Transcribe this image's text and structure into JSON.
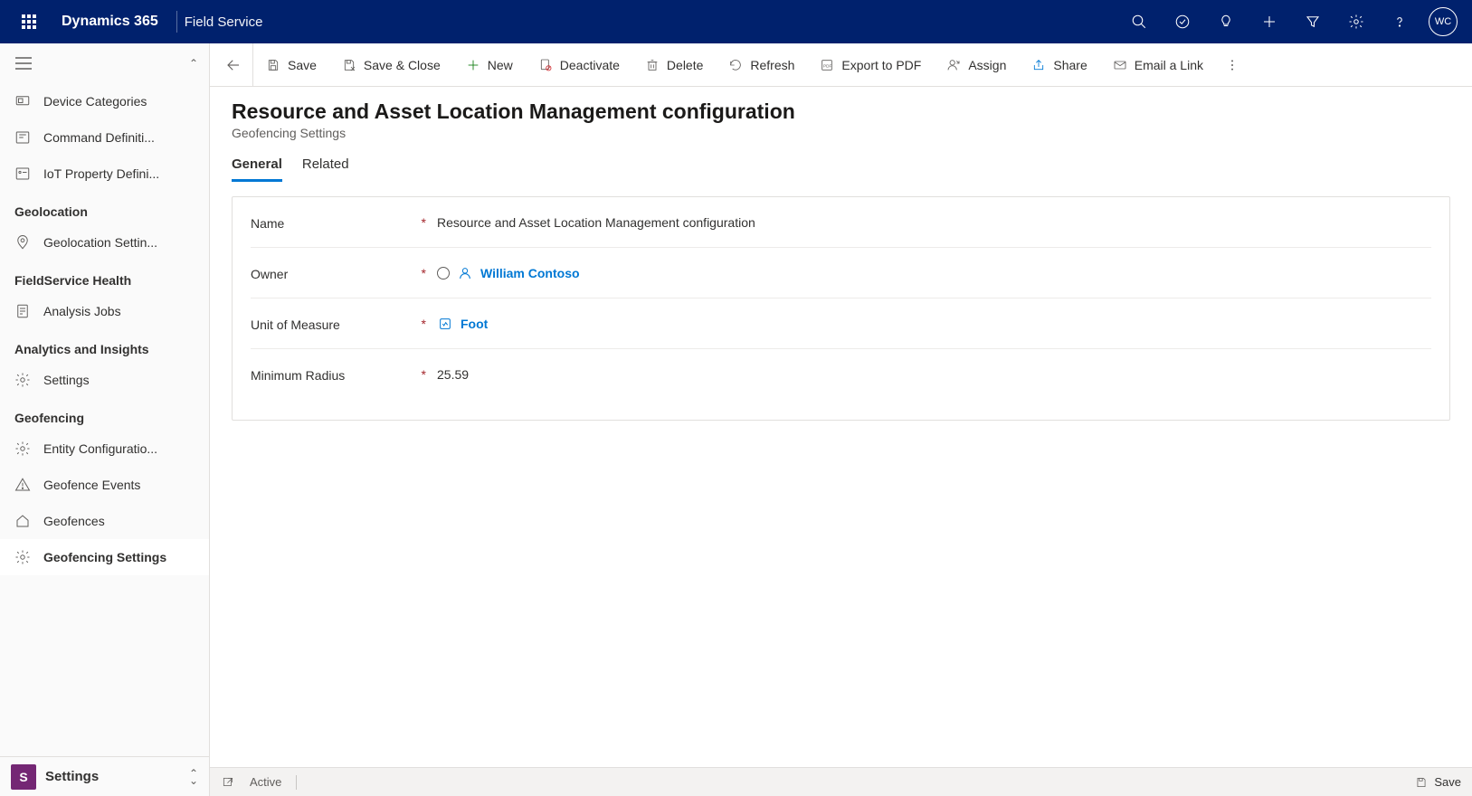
{
  "header": {
    "brand": "Dynamics 365",
    "app_name": "Field Service",
    "avatar_initials": "WC"
  },
  "sidebar": {
    "ungrouped_items": [
      {
        "label": "Device Categories",
        "icon": "devcat"
      },
      {
        "label": "Command Definiti...",
        "icon": "cmddef"
      },
      {
        "label": "IoT Property Defini...",
        "icon": "iotprop"
      }
    ],
    "groups": [
      {
        "title": "Geolocation",
        "items": [
          {
            "label": "Geolocation Settin...",
            "icon": "geo"
          }
        ]
      },
      {
        "title": "FieldService Health",
        "items": [
          {
            "label": "Analysis Jobs",
            "icon": "report"
          }
        ]
      },
      {
        "title": "Analytics and Insights",
        "items": [
          {
            "label": "Settings",
            "icon": "gear"
          }
        ]
      },
      {
        "title": "Geofencing",
        "items": [
          {
            "label": "Entity Configuratio...",
            "icon": "gear"
          },
          {
            "label": "Geofence Events",
            "icon": "warn"
          },
          {
            "label": "Geofences",
            "icon": "house"
          },
          {
            "label": "Geofencing Settings",
            "icon": "gear2",
            "selected": true
          }
        ]
      }
    ],
    "bottom": {
      "badge": "S",
      "label": "Settings"
    }
  },
  "commands": {
    "save": "Save",
    "save_close": "Save & Close",
    "new": "New",
    "deactivate": "Deactivate",
    "delete": "Delete",
    "refresh": "Refresh",
    "export_pdf": "Export to PDF",
    "assign": "Assign",
    "share": "Share",
    "email_link": "Email a Link"
  },
  "page": {
    "title": "Resource and Asset Location Management configuration",
    "subtitle": "Geofencing Settings",
    "tabs": [
      {
        "label": "General",
        "active": true
      },
      {
        "label": "Related",
        "active": false
      }
    ]
  },
  "form": {
    "fields": {
      "name": {
        "label": "Name",
        "value": "Resource and Asset Location Management configuration"
      },
      "owner": {
        "label": "Owner",
        "value": "William Contoso"
      },
      "unit": {
        "label": "Unit of Measure",
        "value": "Foot"
      },
      "min_radius": {
        "label": "Minimum Radius",
        "value": "25.59"
      }
    }
  },
  "status_bar": {
    "state": "Active",
    "save": "Save"
  }
}
